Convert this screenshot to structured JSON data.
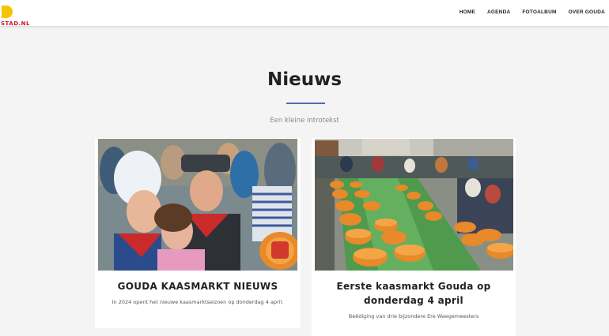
{
  "logo": {
    "text": "STAD.NL",
    "mark_color": "#f5c400",
    "text_color": "#c8102e"
  },
  "nav": {
    "items": [
      "HOME",
      "AGENDA",
      "FOTOALBUM",
      "OVER GOUDA"
    ]
  },
  "section": {
    "title": "Nieuws",
    "intro": "Een kleine introtekst",
    "accent_color": "#4a6fb3"
  },
  "cards": [
    {
      "title": "GOUDA KAASMARKT NIEUWS",
      "text": "In 2024 opent het nieuwe kaasmarktseizoen op donderdag 4 april."
    },
    {
      "title": "Eerste kaasmarkt Gouda op donderdag 4 april",
      "text": "Beëdiging van drie bijzondere Ere Waegemeesters"
    }
  ]
}
